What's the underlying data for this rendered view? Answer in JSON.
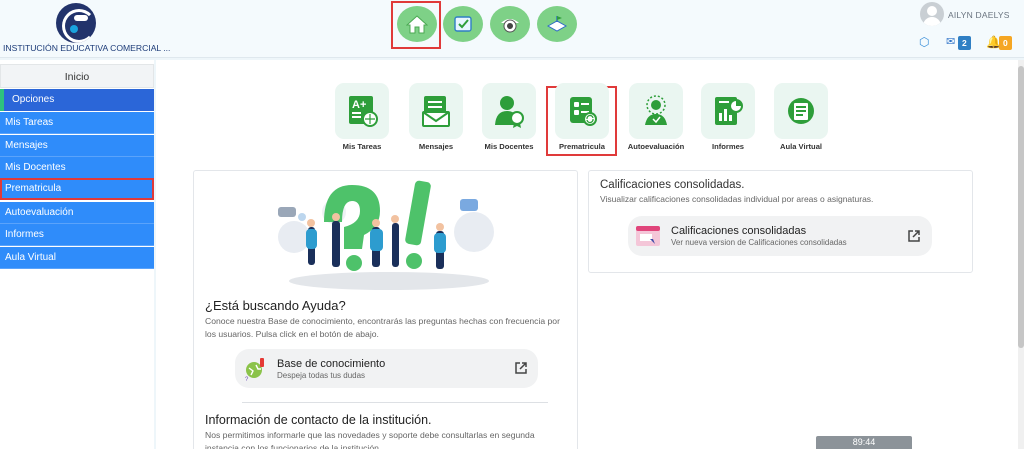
{
  "header": {
    "institution_name": "INSTITUCIÓN EDUCATIVA COMERCIAL ...",
    "user_name": "AILYN DAELYS",
    "messages_count": "2",
    "notifications_count": "0",
    "top_nav": [
      {
        "name": "home-icon"
      },
      {
        "name": "checklist-icon"
      },
      {
        "name": "camera-icon"
      },
      {
        "name": "school-icon"
      }
    ]
  },
  "sidebar": {
    "home_label": "Inicio",
    "section_label": "Opciones",
    "items": [
      {
        "label": "Mis Tareas"
      },
      {
        "label": "Mensajes"
      },
      {
        "label": "Mis Docentes"
      },
      {
        "label": "Prematricula"
      },
      {
        "label": "Autoevaluación"
      },
      {
        "label": "Informes"
      },
      {
        "label": "Aula Virtual"
      }
    ]
  },
  "tiles": [
    {
      "label": "Mis Tareas",
      "icon": "grades-icon"
    },
    {
      "label": "Mensajes",
      "icon": "messages-icon"
    },
    {
      "label": "Mis Docentes",
      "icon": "teacher-icon"
    },
    {
      "label": "Prematricula",
      "icon": "enrollment-icon"
    },
    {
      "label": "Autoevaluación",
      "icon": "self-evaluation-icon"
    },
    {
      "label": "Informes",
      "icon": "reports-icon"
    },
    {
      "label": "Aula Virtual",
      "icon": "virtual-classroom-icon"
    }
  ],
  "help": {
    "title": "¿Está buscando Ayuda?",
    "text": "Conoce nuestra Base de conocimiento, encontrarás las preguntas hechas con frecuencia por los usuarios. Pulsa click en el botón de abajo.",
    "kb_title": "Base de conocimiento",
    "kb_subtitle": "Despeja todas tus dudas",
    "contact_title": "Información de contacto de la institución.",
    "contact_text": "Nos permitimos informarle que las novedades y soporte debe consultarlas en segunda instancia con los funcionarios de la institución."
  },
  "grades": {
    "title": "Calificaciones consolidadas.",
    "subtitle": "Visualizar calificaciones consolidadas individual por areas o asignaturas.",
    "button_title": "Calificaciones consolidadas",
    "button_subtitle": "Ver nueva version de Calificaciones consolidadas"
  },
  "session_timer": "89:44",
  "colors": {
    "sidebar_blue": "#2f8cfa",
    "sidebar_active": "#2b66d8",
    "accent_green": "#2e9e3a",
    "highlight_red": "#e03a3a"
  }
}
